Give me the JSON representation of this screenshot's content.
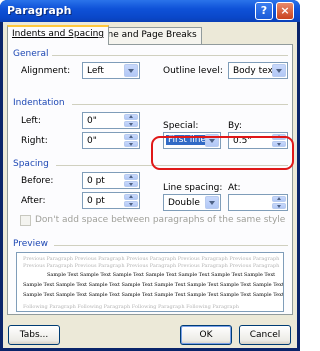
{
  "window": {
    "title": "Paragraph",
    "help_label": "?",
    "close_label": "×"
  },
  "tabs": [
    {
      "label": "Indents and Spacing",
      "active": true
    },
    {
      "label": "Line and Page Breaks",
      "active": false
    }
  ],
  "general": {
    "section_label": "General",
    "alignment_label": "Alignment:",
    "alignment_value": "Left",
    "outline_label": "Outline level:",
    "outline_value": "Body text"
  },
  "indentation": {
    "section_label": "Indentation",
    "left_label": "Left:",
    "left_value": "0\"",
    "right_label": "Right:",
    "right_value": "0\"",
    "special_label": "Special:",
    "special_value": "First line",
    "by_label": "By:",
    "by_value": "0.5\""
  },
  "spacing": {
    "section_label": "Spacing",
    "before_label": "Before:",
    "before_value": "0 pt",
    "after_label": "After:",
    "after_value": "0 pt",
    "line_spacing_label": "Line spacing:",
    "line_spacing_value": "Double",
    "at_label": "At:",
    "at_value": "",
    "dont_add_space_label": "Don't add space between paragraphs of the same style",
    "dont_add_space_checked": false
  },
  "preview": {
    "section_label": "Preview",
    "previous_text": "Previous Paragraph Previous Paragraph Previous Paragraph Previous Paragraph Previous Paragraph",
    "sample_first": "Sample Text Sample Text Sample Text Sample Text Sample Text Sample Text Sample Text",
    "sample_line": "Sample Text Sample Text Sample Text Sample Text Sample Text Sample Text Sample Text Sample Text",
    "following_text": "Following Paragraph Following Paragraph Following Paragraph Following Paragraph"
  },
  "buttons": {
    "tabs": "Tabs...",
    "ok": "OK",
    "cancel": "Cancel"
  },
  "colors": {
    "titlebar": "#0f52d8",
    "section_label": "#1e48b4",
    "highlight": "#e01818",
    "selection": "#316ac5"
  }
}
